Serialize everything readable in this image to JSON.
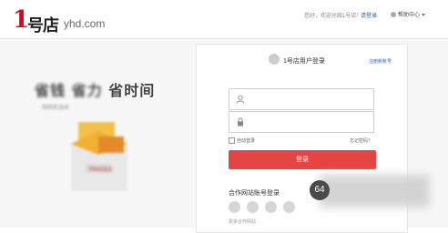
{
  "header": {
    "logo_mark": "1",
    "logo_text": "号店",
    "domain": "yhd.com",
    "greeting": "您好，欢迎光临1号店！",
    "login_link": "请登录",
    "help_label": "帮助中心"
  },
  "promo": {
    "slogan_1": "省钱",
    "slogan_2": "省力",
    "slogan_3": "省时间",
    "sub": "网购新选择"
  },
  "login": {
    "title": "1号店用户登录",
    "register_link": "注册新账号",
    "username_placeholder": "",
    "password_placeholder": "",
    "remember_label": "自动登录",
    "forgot_label": "忘记密码？",
    "submit_label": "登录",
    "partner_title": "合作网站账号登录",
    "more_partners": "更多合作网站"
  },
  "overlay": {
    "badge": "64"
  },
  "colors": {
    "brand_red": "#e5001f",
    "button_red": "#e64343",
    "link_blue": "#2b63b0"
  },
  "icons": [
    "user-icon",
    "lock-icon",
    "help-icon",
    "avatar-icon",
    "weibo-icon",
    "qq-icon",
    "wechat-icon",
    "alipay-icon"
  ]
}
